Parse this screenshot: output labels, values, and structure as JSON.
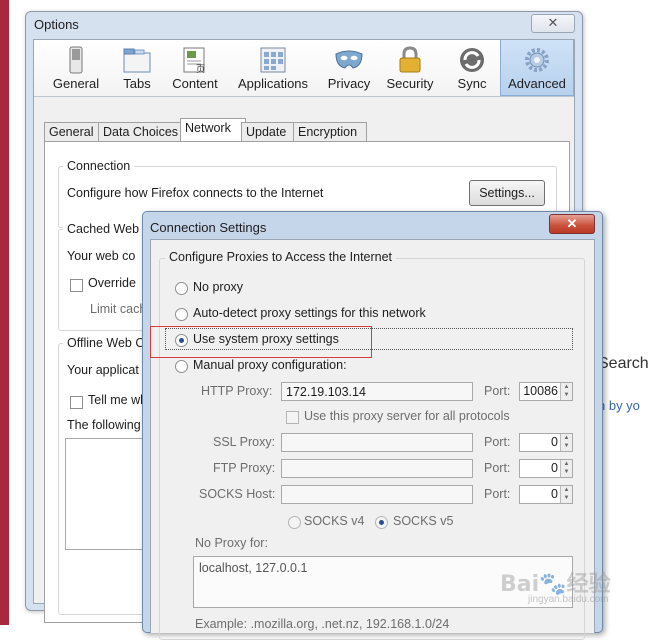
{
  "options_window": {
    "title": "Options",
    "close_glyph": "✕",
    "panes": [
      {
        "label": "General",
        "icon": "general-switch-icon"
      },
      {
        "label": "Tabs",
        "icon": "tabs-icon"
      },
      {
        "label": "Content",
        "icon": "content-icon"
      },
      {
        "label": "Applications",
        "icon": "applications-icon"
      },
      {
        "label": "Privacy",
        "icon": "privacy-mask-icon"
      },
      {
        "label": "Security",
        "icon": "security-lock-icon"
      },
      {
        "label": "Sync",
        "icon": "sync-icon"
      },
      {
        "label": "Advanced",
        "icon": "advanced-gear-icon"
      }
    ],
    "selected_pane": "Advanced",
    "tabs": [
      "General",
      "Data Choices",
      "Network",
      "Update",
      "Encryption"
    ],
    "selected_tab": "Network",
    "connection": {
      "title": "Connection",
      "description": "Configure how Firefox connects to the Internet",
      "settings_button": "Settings..."
    },
    "cached_web": {
      "title_partial": "Cached Web C",
      "line_partial": "Your web co",
      "override_partial": "Override",
      "limit_partial": "Limit cach"
    },
    "offline_web": {
      "title_partial": "Offline Web C",
      "line_partial": "Your applicat",
      "tell_partial": "Tell me wh",
      "following_partial": "The following"
    }
  },
  "connection_settings": {
    "title": "Connection Settings",
    "close_glyph": "✕",
    "group_title": "Configure Proxies to Access the Internet",
    "options": {
      "no_proxy": "No proxy",
      "auto_detect": "Auto-detect proxy settings for this network",
      "system": "Use system proxy settings",
      "manual": "Manual proxy configuration:"
    },
    "selected_option": "system",
    "http_label": "HTTP Proxy:",
    "http_value": "172.19.103.14",
    "http_port_label": "Port:",
    "http_port": "10086",
    "same_proxy_label": "Use this proxy server for all protocols",
    "ssl_label": "SSL Proxy:",
    "ftp_label": "FTP Proxy:",
    "socks_label": "SOCKS Host:",
    "port_label": "Port:",
    "ssl_port": "0",
    "ftp_port": "0",
    "socks_port": "0",
    "socks_v4": "SOCKS v4",
    "socks_v5": "SOCKS v5",
    "no_proxy_label": "No Proxy for:",
    "no_proxy_value": "localhost, 127.0.0.1",
    "example": "Example: .mozilla.org, .net.nz, 192.168.1.0/24"
  },
  "background": {
    "search_partial": "Search",
    "sub_partial": "n by yo"
  },
  "watermark": {
    "brand": "Bai",
    "brand2": "经验",
    "url": "jingyan.baidu.com"
  },
  "colors": {
    "highlight_box": "#d83c3c",
    "side_bar": "#a8283e",
    "selected_pane": "#b7d1ee"
  }
}
